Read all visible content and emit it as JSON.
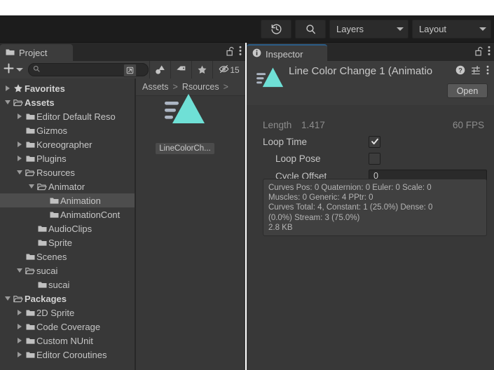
{
  "toolbar": {
    "history_icon": "history-clock-icon",
    "search_icon": "search-icon",
    "layers_label": "Layers",
    "layout_label": "Layout"
  },
  "project_panel": {
    "tab_label": "Project",
    "tab_icon": "folder-icon",
    "lock_icon": "lock-open-icon",
    "menu_icon": "kebab-menu-icon",
    "create_label": "+",
    "search_placeholder": "",
    "search_value": "",
    "filter_icons": [
      "asset-type-filter-icon",
      "label-tag-icon",
      "favorite-star-icon"
    ],
    "hidden_count": "15",
    "breadcrumb": [
      "Assets",
      "Rsources",
      ""
    ],
    "breadcrumb_sep": ">",
    "tree": [
      {
        "label": "Favorites",
        "depth": 0,
        "arrow": "right",
        "icon": "star-icon",
        "bold": true,
        "selected": false
      },
      {
        "label": "Assets",
        "depth": 0,
        "arrow": "down",
        "icon": "folder-open-icon",
        "bold": true,
        "selected": false
      },
      {
        "label": "Editor Default Reso",
        "depth": 1,
        "arrow": "right",
        "icon": "folder-icon",
        "bold": false,
        "selected": false
      },
      {
        "label": "Gizmos",
        "depth": 1,
        "arrow": "none",
        "icon": "folder-icon",
        "bold": false,
        "selected": false
      },
      {
        "label": "Koreographer",
        "depth": 1,
        "arrow": "right",
        "icon": "folder-icon",
        "bold": false,
        "selected": false
      },
      {
        "label": "Plugins",
        "depth": 1,
        "arrow": "right",
        "icon": "folder-icon",
        "bold": false,
        "selected": false
      },
      {
        "label": "Rsources",
        "depth": 1,
        "arrow": "down",
        "icon": "folder-open-icon",
        "bold": false,
        "selected": false
      },
      {
        "label": "Animator",
        "depth": 2,
        "arrow": "down",
        "icon": "folder-open-icon",
        "bold": false,
        "selected": false
      },
      {
        "label": "Animation",
        "depth": 3,
        "arrow": "none",
        "icon": "folder-icon",
        "bold": false,
        "selected": true
      },
      {
        "label": "AnimationCont",
        "depth": 3,
        "arrow": "none",
        "icon": "folder-icon",
        "bold": false,
        "selected": false
      },
      {
        "label": "AudioClips",
        "depth": 2,
        "arrow": "none",
        "icon": "folder-icon",
        "bold": false,
        "selected": false
      },
      {
        "label": "Sprite",
        "depth": 2,
        "arrow": "none",
        "icon": "folder-icon",
        "bold": false,
        "selected": false
      },
      {
        "label": "Scenes",
        "depth": 1,
        "arrow": "none",
        "icon": "folder-icon",
        "bold": false,
        "selected": false
      },
      {
        "label": "sucai",
        "depth": 1,
        "arrow": "down",
        "icon": "folder-open-icon",
        "bold": false,
        "selected": false
      },
      {
        "label": "sucai",
        "depth": 2,
        "arrow": "none",
        "icon": "folder-icon",
        "bold": false,
        "selected": false
      },
      {
        "label": "Packages",
        "depth": 0,
        "arrow": "down",
        "icon": "folder-open-icon",
        "bold": true,
        "selected": false
      },
      {
        "label": "2D Sprite",
        "depth": 1,
        "arrow": "right",
        "icon": "folder-icon",
        "bold": false,
        "selected": false
      },
      {
        "label": "Code Coverage",
        "depth": 1,
        "arrow": "right",
        "icon": "folder-icon",
        "bold": false,
        "selected": false
      },
      {
        "label": "Custom NUnit",
        "depth": 1,
        "arrow": "right",
        "icon": "folder-icon",
        "bold": false,
        "selected": false
      },
      {
        "label": "Editor Coroutines",
        "depth": 1,
        "arrow": "right",
        "icon": "folder-icon",
        "bold": false,
        "selected": false
      }
    ],
    "asset": {
      "name": "LineColorCh...",
      "icon": "animation-clip-icon"
    }
  },
  "inspector_panel": {
    "tab_label": "Inspector",
    "tab_icon": "info-icon",
    "lock_icon": "lock-open-icon",
    "menu_icon": "kebab-menu-icon",
    "object_title": "Line Color Change 1 (Animatio",
    "object_icon": "animation-clip-icon",
    "help_icon": "help-circle-icon",
    "preset_icon": "preset-settings-icon",
    "context_icon": "kebab-menu-icon",
    "open_button": "Open",
    "length_label": "Length",
    "length_value": "1.417",
    "fps_value": "60 FPS",
    "loop_time_label": "Loop Time",
    "loop_time_checked": true,
    "loop_pose_label": "Loop Pose",
    "loop_pose_checked": false,
    "cycle_offset_label": "Cycle Offset",
    "cycle_offset_value": "0",
    "stats_lines": [
      "Curves Pos: 0 Quaternion: 0 Euler: 0 Scale: 0",
      "Muscles: 0 Generic: 4 PPtr: 0",
      "Curves Total: 4, Constant: 1 (25.0%) Dense: 0",
      "(0.0%) Stream: 3 (75.0%)",
      "2.8 KB"
    ]
  },
  "colors": {
    "panel_bg": "#383838",
    "header_bg": "#3c3c3c",
    "toolbar_bg": "#1c1c1c",
    "accent_teal": "#6fe0d6",
    "selection": "#4d4d4d",
    "tab_accent_blue": "#2c5d87",
    "text": "#c6c6c6"
  }
}
